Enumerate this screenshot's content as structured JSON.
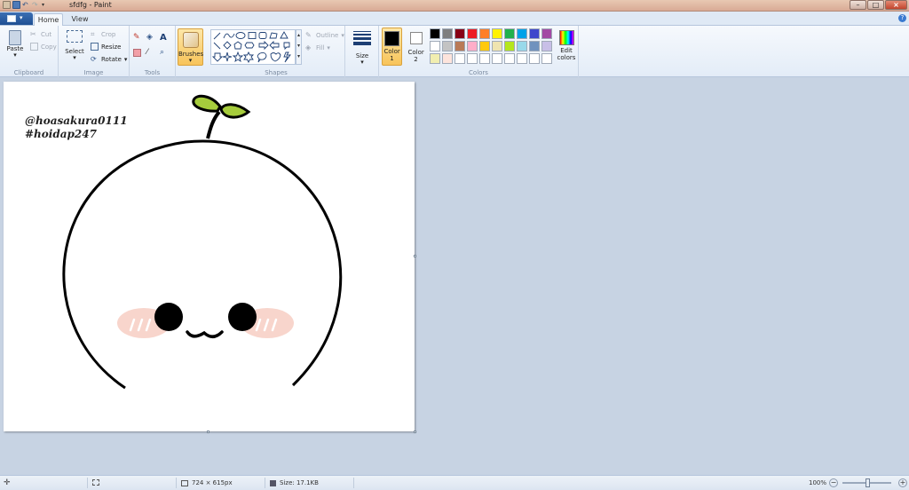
{
  "window": {
    "title": "sfdfg - Paint",
    "minimize": "–",
    "maximize": "□",
    "close": "×"
  },
  "tabs": {
    "home": "Home",
    "view": "View",
    "help": "?"
  },
  "ribbon": {
    "clipboard": {
      "paste": "Paste",
      "cut": "Cut",
      "copy": "Copy",
      "label": "Clipboard"
    },
    "image": {
      "select": "Select",
      "crop": "Crop",
      "resize": "Resize",
      "rotate": "Rotate",
      "label": "Image"
    },
    "tools": {
      "label": "Tools",
      "text_tool": "A"
    },
    "brushes": {
      "label": "Brushes"
    },
    "shapes": {
      "outline": "Outline",
      "fill": "Fill",
      "label": "Shapes"
    },
    "size": {
      "label": "Size"
    },
    "colors": {
      "color1": "Color 1",
      "color2": "Color 2",
      "edit": "Edit colors",
      "label": "Colors",
      "color1_value": "#000000",
      "color2_value": "#ffffff",
      "palette_row1": [
        "#000000",
        "#7f7f7f",
        "#880015",
        "#ed1c24",
        "#ff7f27",
        "#fff200",
        "#22b14c",
        "#00a2e8",
        "#3f48cc",
        "#a349a4"
      ],
      "palette_row2": [
        "#ffffff",
        "#c3c3c3",
        "#b97a57",
        "#ffaec9",
        "#ffc90e",
        "#efe4b0",
        "#b5e61d",
        "#99d9ea",
        "#7092be",
        "#c8bfe7"
      ],
      "palette_row3": [
        "#f1eeb0",
        "#fde4dc",
        "",
        "",
        "",
        "",
        "",
        "",
        "",
        ""
      ]
    }
  },
  "canvas": {
    "text_line1": "@hoasakura0111",
    "text_line2": "#hoidap247"
  },
  "status": {
    "dimensions": "724 × 615px",
    "size": "Size: 17.1KB",
    "zoom": "100%",
    "zoom_out": "−",
    "zoom_in": "+"
  }
}
